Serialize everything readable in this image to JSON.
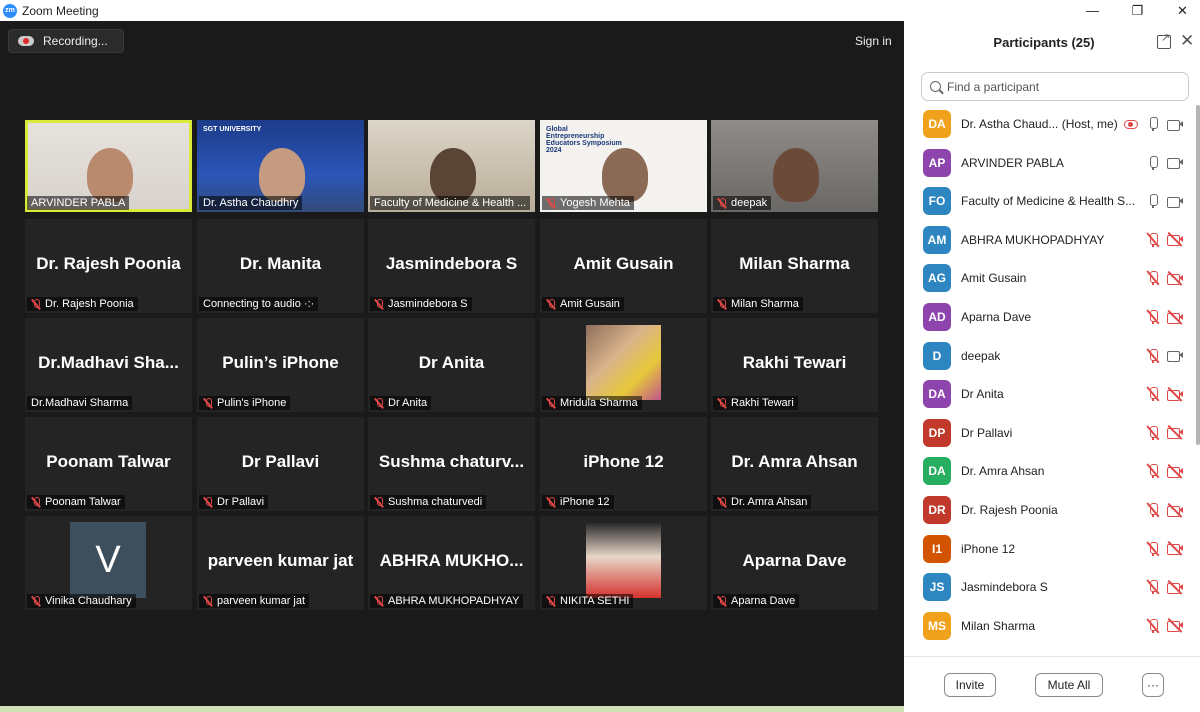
{
  "window": {
    "app_logo": "zm",
    "title": "Zoom Meeting",
    "controls": [
      "minimize",
      "maximize",
      "close"
    ]
  },
  "toolbar": {
    "recording_label": "Recording...",
    "sign_in_label": "Sign in"
  },
  "gallery": {
    "tiles": [
      {
        "type": "video",
        "label": "ARVINDER PABLA",
        "muted": false,
        "active": true
      },
      {
        "type": "video",
        "label": "Dr. Astha Chaudhry",
        "muted": false,
        "slide_text": "SGT UNIVERSITY"
      },
      {
        "type": "video",
        "label": "Faculty of Medicine & Health ...",
        "muted": false
      },
      {
        "type": "video",
        "label": "Yogesh Mehta",
        "muted": true,
        "slide_text": "Global Entrepreneurship Educators Symposium 2024"
      },
      {
        "type": "video",
        "label": "deepak",
        "muted": true
      },
      {
        "type": "name",
        "display": "Dr. Rajesh Poonia",
        "label": "Dr. Rajesh Poonia",
        "muted": true
      },
      {
        "type": "name",
        "display": "Dr. Manita",
        "label": "Connecting to audio ·:·",
        "muted": false
      },
      {
        "type": "name",
        "display": "Jasmindebora S",
        "label": "Jasmindebora S",
        "muted": true
      },
      {
        "type": "name",
        "display": "Amit Gusain",
        "label": "Amit Gusain",
        "muted": true
      },
      {
        "type": "name",
        "display": "Milan Sharma",
        "label": "Milan Sharma",
        "muted": true
      },
      {
        "type": "name",
        "display": "Dr.Madhavi  Sha...",
        "label": "Dr.Madhavi Sharma",
        "muted": false
      },
      {
        "type": "name",
        "display": "Pulin’s iPhone",
        "label": "Pulin's iPhone",
        "muted": true
      },
      {
        "type": "name",
        "display": "Dr Anita",
        "label": "Dr Anita",
        "muted": true
      },
      {
        "type": "photo",
        "label": "Mridula Sharma",
        "muted": true
      },
      {
        "type": "name",
        "display": "Rakhi Tewari",
        "label": "Rakhi Tewari",
        "muted": true
      },
      {
        "type": "name",
        "display": "Poonam Talwar",
        "label": "Poonam Talwar",
        "muted": true
      },
      {
        "type": "name",
        "display": "Dr Pallavi",
        "label": "Dr Pallavi",
        "muted": true
      },
      {
        "type": "name",
        "display": "Sushma  chaturv...",
        "label": "Sushma chaturvedi",
        "muted": true
      },
      {
        "type": "name",
        "display": "iPhone 12",
        "label": "iPhone 12",
        "muted": true
      },
      {
        "type": "name",
        "display": "Dr. Amra Ahsan",
        "label": "Dr. Amra Ahsan",
        "muted": true
      },
      {
        "type": "letter",
        "letter": "V",
        "label": "Vinika Chaudhary",
        "muted": true
      },
      {
        "type": "name",
        "display": "parveen kumar jat",
        "label": "parveen kumar jat",
        "muted": true
      },
      {
        "type": "name",
        "display": "ABHRA  MUKHO...",
        "label": "ABHRA MUKHOPADHYAY",
        "muted": true
      },
      {
        "type": "photo2",
        "label": "NIKITA SETHI",
        "muted": true
      },
      {
        "type": "name",
        "display": "Aparna Dave",
        "label": "Aparna Dave",
        "muted": true
      }
    ]
  },
  "participants": {
    "title": "Participants (25)",
    "search_placeholder": "Find a participant",
    "list": [
      {
        "initials": "DA",
        "name": "Dr. Astha Chaud...  (Host, me)",
        "color": "#f0a21c",
        "mic_muted": false,
        "cam_muted": false,
        "sharing": true
      },
      {
        "initials": "AP",
        "name": "ARVINDER PABLA",
        "color": "#8e44ad",
        "mic_muted": false,
        "cam_muted": false
      },
      {
        "initials": "FO",
        "name": "Faculty of Medicine & Health S...",
        "color": "#2e86c1",
        "mic_muted": false,
        "cam_muted": false
      },
      {
        "initials": "AM",
        "name": "ABHRA MUKHOPADHYAY",
        "color": "#2e86c1",
        "mic_muted": true,
        "cam_muted": true
      },
      {
        "initials": "AG",
        "name": "Amit Gusain",
        "color": "#2e86c1",
        "mic_muted": true,
        "cam_muted": true
      },
      {
        "initials": "AD",
        "name": "Aparna Dave",
        "color": "#8e44ad",
        "mic_muted": true,
        "cam_muted": true
      },
      {
        "initials": "D",
        "name": "deepak",
        "color": "#2e86c1",
        "mic_muted": true,
        "cam_muted": false
      },
      {
        "initials": "DA",
        "name": "Dr Anita",
        "color": "#8e44ad",
        "mic_muted": true,
        "cam_muted": true
      },
      {
        "initials": "DP",
        "name": "Dr Pallavi",
        "color": "#c0392b",
        "mic_muted": true,
        "cam_muted": true
      },
      {
        "initials": "DA",
        "name": "Dr. Amra Ahsan",
        "color": "#27ae60",
        "mic_muted": true,
        "cam_muted": true
      },
      {
        "initials": "DR",
        "name": "Dr. Rajesh Poonia",
        "color": "#c0392b",
        "mic_muted": true,
        "cam_muted": true
      },
      {
        "initials": "I1",
        "name": "iPhone 12",
        "color": "#d35400",
        "mic_muted": true,
        "cam_muted": true
      },
      {
        "initials": "JS",
        "name": "Jasmindebora S",
        "color": "#2e86c1",
        "mic_muted": true,
        "cam_muted": true
      },
      {
        "initials": "MS",
        "name": "Milan Sharma",
        "color": "#f0a21c",
        "mic_muted": true,
        "cam_muted": true
      }
    ],
    "invite_label": "Invite",
    "mute_all_label": "Mute All",
    "more_label": "···"
  }
}
